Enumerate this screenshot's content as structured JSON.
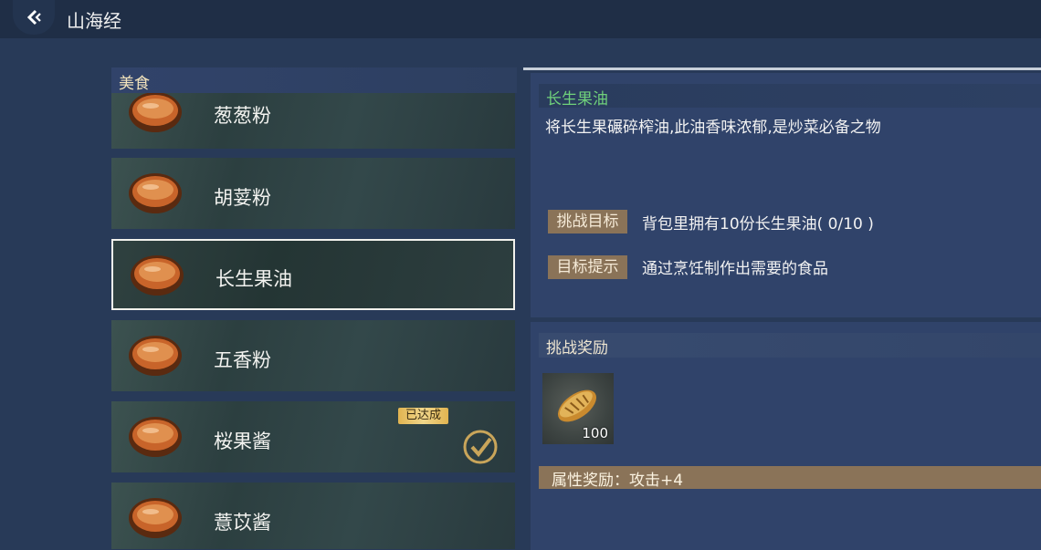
{
  "header": {
    "title": "山海经"
  },
  "left_panel": {
    "category": "美食",
    "items": [
      {
        "name": "葱葱粉"
      },
      {
        "name": "胡荽粉"
      },
      {
        "name": "长生果油"
      },
      {
        "name": "五香粉"
      },
      {
        "name": "桜果酱",
        "badge": "已达成"
      },
      {
        "name": "薏苡酱"
      }
    ]
  },
  "detail": {
    "name": "长生果油",
    "description": "将长生果碾碎榨油,此油香味浓郁,是炒菜必备之物",
    "goal_label": "挑战目标",
    "goal_text": "背包里拥有10份长生果油( 0/10 )",
    "hint_label": "目标提示",
    "hint_text": "通过烹饪制作出需要的食品"
  },
  "reward": {
    "title": "挑战奖励",
    "item_count": "100",
    "attr": "属性奖励：攻击+4"
  }
}
